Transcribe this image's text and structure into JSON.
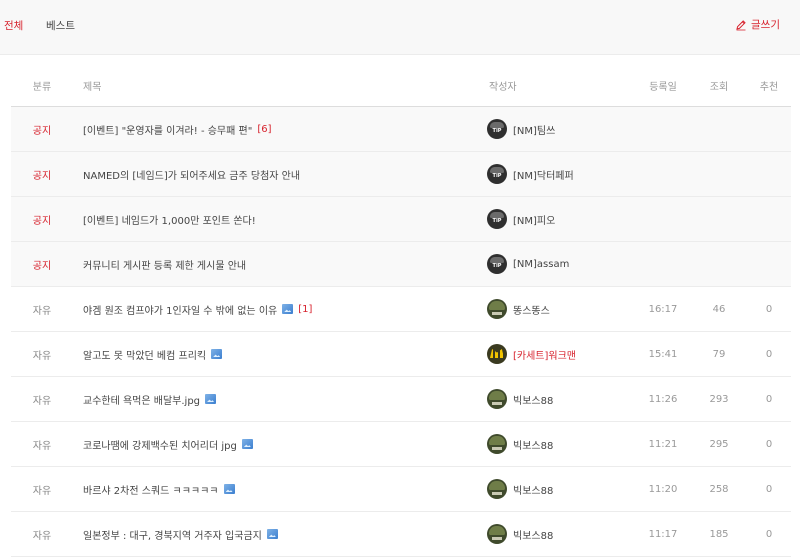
{
  "tabs": [
    {
      "label": "전체"
    },
    {
      "label": "베스트"
    }
  ],
  "write_label": "글쓰기",
  "columns": {
    "category": "분류",
    "title": "제목",
    "author": "작성자",
    "date": "등록일",
    "views": "조회",
    "recommend": "추천"
  },
  "notices": [
    {
      "category": "공지",
      "title": "[이벤트] \"운영자를 이겨라! - 승무패 편\"",
      "comments": "[6]",
      "author": "[NM]팀쓰"
    },
    {
      "category": "공지",
      "title": "NAMED의 [네임드]가 되어주세요 금주 당첨자 안내",
      "author": "[NM]닥터페퍼"
    },
    {
      "category": "공지",
      "title": "[이벤트] 네임드가 1,000만 포인트 쏜다!",
      "author": "[NM]피오"
    },
    {
      "category": "공지",
      "title": "커뮤니티 게시판 등록 제한 게시물 안내",
      "author": "[NM]assam"
    }
  ],
  "posts": [
    {
      "category": "자유",
      "title": "야겜 원조 컴프야가 1인자일 수 밖에 없는 이유",
      "has_image": true,
      "comments": "[1]",
      "author": "똥스똥스",
      "date": "16:17",
      "views": "46",
      "recommend": "0",
      "avatar": "soldier"
    },
    {
      "category": "자유",
      "title": "알고도 못 막았던 베컴 프리킥",
      "has_image": true,
      "comments": "",
      "author": "[카세트]워크맨",
      "date": "15:41",
      "views": "79",
      "recommend": "0",
      "avatar": "gold"
    },
    {
      "category": "자유",
      "title": "교수한테 욕먹은 배달부.jpg",
      "has_image": true,
      "comments": "",
      "author": "빅보스88",
      "date": "11:26",
      "views": "293",
      "recommend": "0",
      "avatar": "soldier"
    },
    {
      "category": "자유",
      "title": "코로나땜에 강제백수된 치어리더 jpg",
      "has_image": true,
      "comments": "",
      "author": "빅보스88",
      "date": "11:21",
      "views": "295",
      "recommend": "0",
      "avatar": "soldier"
    },
    {
      "category": "자유",
      "title": "바르샤 2차전 스쿼드 ㅋㅋㅋㅋㅋ",
      "has_image": true,
      "comments": "",
      "author": "빅보스88",
      "date": "11:20",
      "views": "258",
      "recommend": "0",
      "avatar": "soldier"
    },
    {
      "category": "자유",
      "title": "일본정부 : 대구, 경북지역 거주자 입국금지",
      "has_image": true,
      "comments": "",
      "author": "빅보스88",
      "date": "11:17",
      "views": "185",
      "recommend": "0",
      "avatar": "soldier"
    }
  ],
  "colors": {
    "accent": "#d7232e"
  }
}
